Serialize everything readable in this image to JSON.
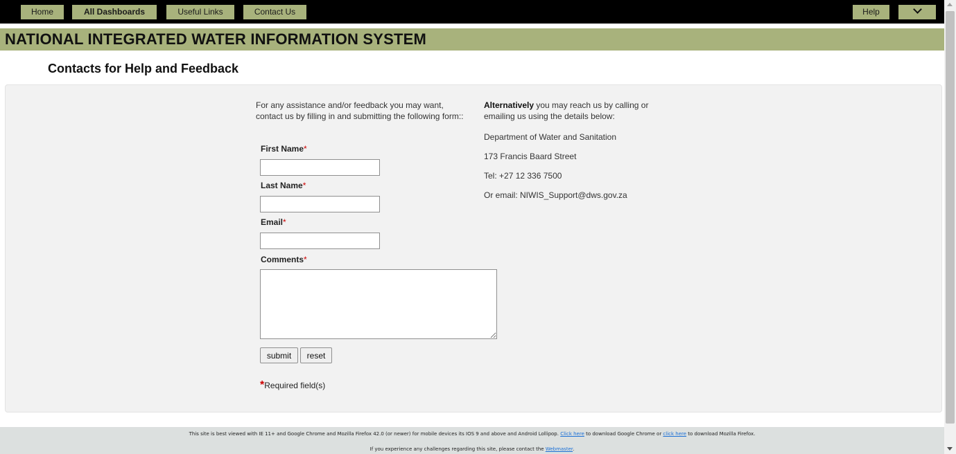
{
  "nav": {
    "home": "Home",
    "all_dashboards": "All Dashboards",
    "useful_links": "Useful Links",
    "contact_us": "Contact Us",
    "help": "Help",
    "menu_icon": "chevron-down-icon"
  },
  "banner": {
    "title": "NATIONAL INTEGRATED WATER INFORMATION SYSTEM"
  },
  "page": {
    "heading": "Contacts for Help and Feedback"
  },
  "form": {
    "intro": "For any assistance and/or feedback you may want, contact us by filling in and submitting the following form::",
    "first_name_label": "First Name",
    "last_name_label": "Last Name",
    "email_label": "Email",
    "comments_label": "Comments",
    "required_marker": "*",
    "first_name_value": "",
    "last_name_value": "",
    "email_value": "",
    "comments_value": "",
    "submit_label": "submit",
    "reset_label": "reset",
    "required_note": "Required field(s)"
  },
  "contact": {
    "alt_bold": "Alternatively",
    "alt_rest": " you may reach us by calling or emailing us using the details below:",
    "department": "Department of Water and Sanitation",
    "address": "173 Francis Baard Street",
    "tel": "Tel: +27 12 336 7500",
    "email": "Or email: NIWIS_Support@dws.gov.za"
  },
  "footer": {
    "line1_a": "This site is best viewed with IE 11+ and Google Chrome and Mozilla Firefox 42.0 (or newer) for mobile devices its IOS 9 and above and Android Lollipop.  ",
    "link_chrome": "Click here",
    "line1_b": " to download Google Chrome or ",
    "link_firefox": "click here",
    "line1_c": " to download Mozilla Firefox.",
    "line2_a": "If you experience any challenges regarding this site, please contact the ",
    "link_webmaster": "Webmaster",
    "line2_b": "."
  },
  "colors": {
    "accent": "#a8b27c",
    "topbar": "#000000",
    "panel": "#f2f2f2",
    "required": "#cc0000",
    "link": "#1a6fd6"
  }
}
